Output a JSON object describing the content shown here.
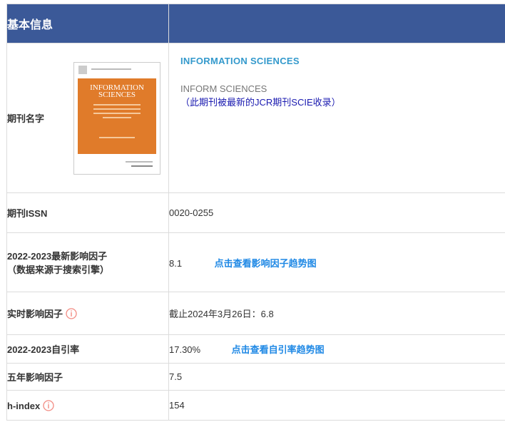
{
  "header": {
    "title": "基本信息"
  },
  "journal": {
    "label": "期刊名字",
    "full_name": "INFORMATION SCIENCES",
    "abbr": "INFORM SCIENCES",
    "note": "（此期刊被最新的JCR期刊SCIE收录）",
    "cover_title_1": "INFORMATION",
    "cover_title_2": "SCIENCES"
  },
  "issn": {
    "label": "期刊ISSN",
    "value": "0020-0255"
  },
  "impact_factor": {
    "label_1": "2022-2023最新影响因子",
    "label_2": "（数据来源于搜索引擎）",
    "value": "8.1",
    "link": "点击查看影响因子趋势图"
  },
  "realtime_if": {
    "label": "实时影响因子",
    "value": "截止2024年3月26日：6.8"
  },
  "self_citation": {
    "label": "2022-2023自引率",
    "value": "17.30%",
    "link": "点击查看自引率趋势图"
  },
  "five_year_if": {
    "label": "五年影响因子",
    "value": "7.5"
  },
  "h_index": {
    "label": "h-index",
    "value": "154"
  },
  "colors": {
    "header_bg": "#3b5998",
    "link": "#1e88e5",
    "info_icon": "#f28b82"
  }
}
